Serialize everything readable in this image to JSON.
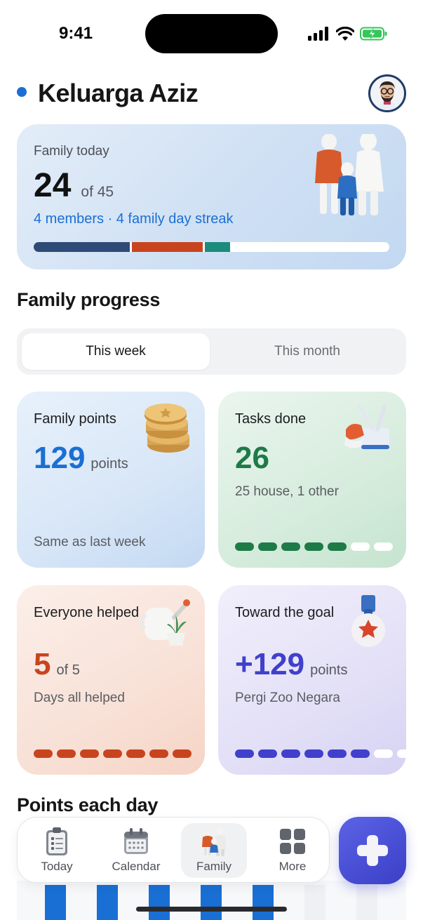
{
  "status": {
    "time": "9:41"
  },
  "header": {
    "title": "Keluarga Aziz"
  },
  "hero": {
    "label": "Family today",
    "count": "24",
    "of": "of 45",
    "subtitle": "4 members · 4 family day streak",
    "segments": [
      {
        "color": "#2e4a77",
        "fraction": 0.27
      },
      {
        "color": "#c8441e",
        "fraction": 0.2
      },
      {
        "color": "#1c8a7c",
        "fraction": 0.07
      }
    ]
  },
  "progress": {
    "title": "Family progress",
    "tabs": {
      "active": "This week",
      "inactive": "This month"
    }
  },
  "cards": {
    "points": {
      "title": "Family points",
      "value": "129",
      "unit": "points",
      "sub": "Same as last week",
      "color": "#1a6fd4"
    },
    "tasks": {
      "title": "Tasks done",
      "value": "26",
      "sub": "25 house, 1 other",
      "color": "#1e7a47",
      "filled": 5,
      "total": 7
    },
    "helped": {
      "title": "Everyone helped",
      "value": "5",
      "unit": "of 5",
      "sub": "Days all helped",
      "color": "#c8441e",
      "filled": 7,
      "total": 7
    },
    "goal": {
      "title": "Toward the goal",
      "value": "+129",
      "unit": "points",
      "sub": "Pergi Zoo Negara",
      "color": "#4040cc",
      "filled": 6,
      "total": 8
    }
  },
  "daily": {
    "title": "Points each day",
    "fractions": [
      0.9,
      0.9,
      0.9,
      0.9,
      0.9,
      0.9,
      0.9
    ]
  },
  "tabbar": {
    "today": "Today",
    "calendar": "Calendar",
    "family": "Family",
    "more": "More"
  },
  "colors": {
    "accent": "#1a6fd4",
    "fab": "#4a50d8"
  }
}
